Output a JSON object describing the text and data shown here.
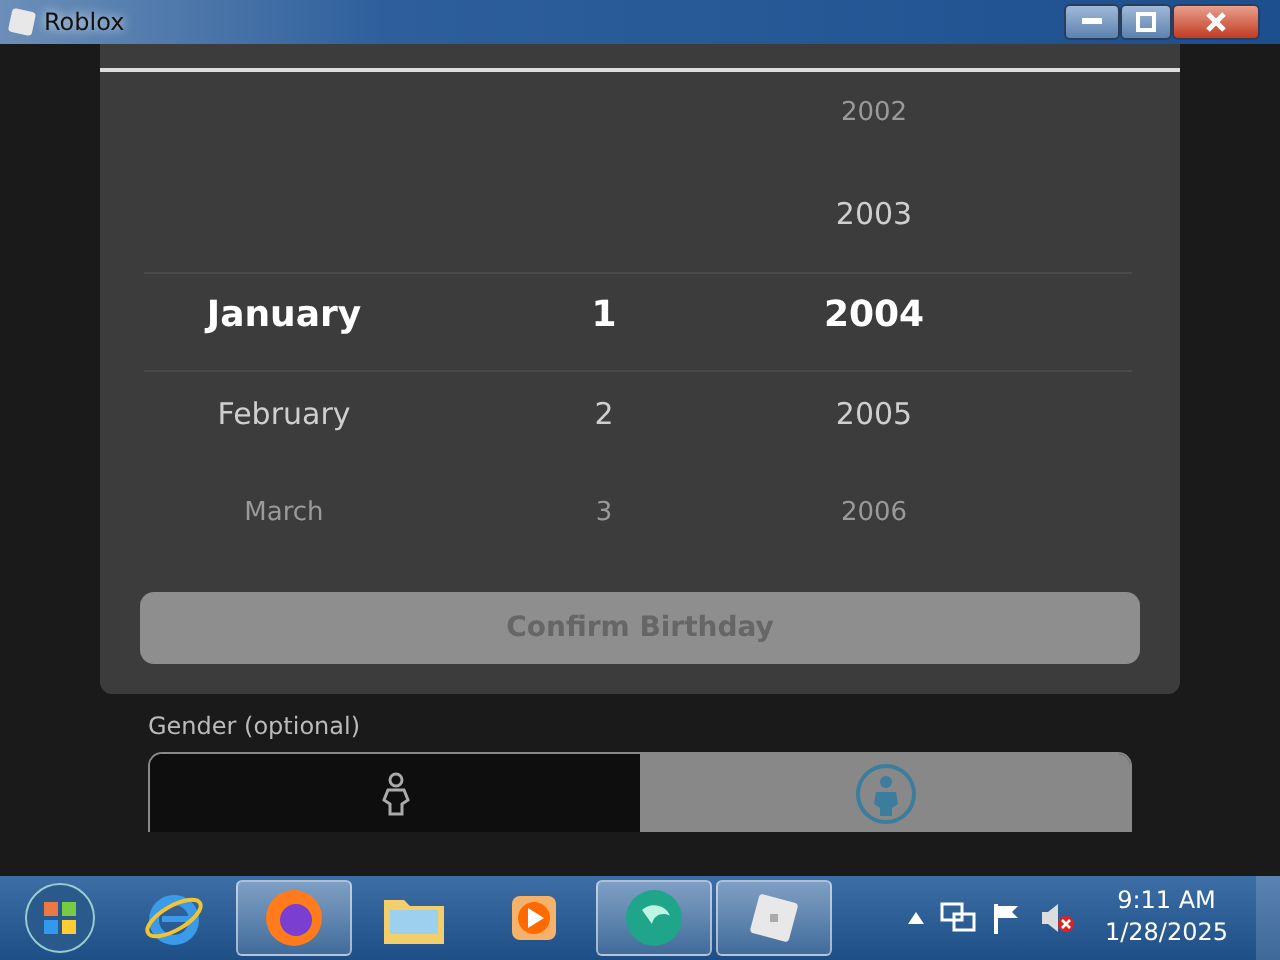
{
  "window": {
    "title": "Roblox"
  },
  "birthday_picker": {
    "months": [
      {
        "label": "January",
        "selected": true
      },
      {
        "label": "February",
        "selected": false
      },
      {
        "label": "March",
        "selected": false
      }
    ],
    "days": [
      {
        "label": "1",
        "selected": true
      },
      {
        "label": "2",
        "selected": false
      },
      {
        "label": "3",
        "selected": false
      }
    ],
    "years": [
      {
        "label": "2002",
        "selected": false
      },
      {
        "label": "2003",
        "selected": false
      },
      {
        "label": "2004",
        "selected": true
      },
      {
        "label": "2005",
        "selected": false
      },
      {
        "label": "2006",
        "selected": false
      }
    ],
    "confirm_button": {
      "label": "Confirm Birthday",
      "disabled": true
    }
  },
  "gender": {
    "label": "Gender (optional)",
    "options": [
      {
        "selected": true
      },
      {
        "selected": false
      }
    ]
  },
  "taskbar": {
    "apps": [
      {
        "kind": "ie",
        "active": false
      },
      {
        "kind": "firefox",
        "active": true
      },
      {
        "kind": "explorer",
        "active": false
      },
      {
        "kind": "media",
        "active": false
      },
      {
        "kind": "app",
        "active": true
      },
      {
        "kind": "roblox",
        "active": true
      }
    ],
    "time": "9:11 AM",
    "date": "1/28/2025"
  }
}
